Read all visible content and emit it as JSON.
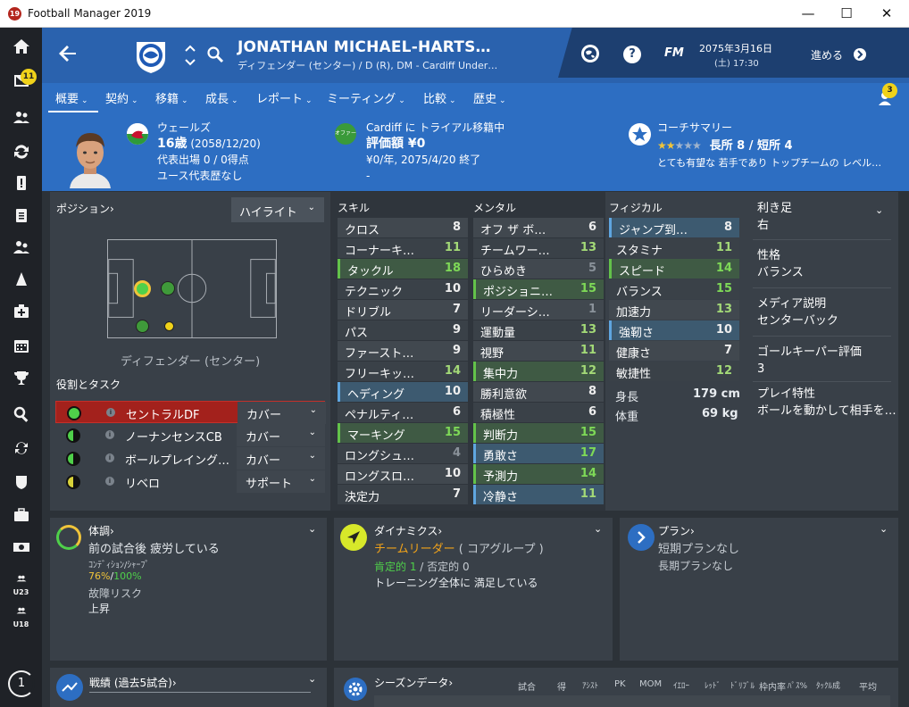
{
  "window": {
    "title": "Football Manager 2019",
    "app_icon": "19",
    "minimize": "—",
    "maximize": "☐",
    "close": "✕"
  },
  "sidebar": {
    "inbox_badge": "11",
    "level": "1",
    "u23": "U23",
    "u18": "U18"
  },
  "header": {
    "player_name": "JONATHAN MICHAEL-HARTS…",
    "player_sub": "ディフェンダー (センター) / D (R), DM - Cardiff Under…",
    "date": "2075年3月16日",
    "time": "(土) 17:30",
    "fm": "FM",
    "help": "?",
    "continue": "進める",
    "notif_badge": "3"
  },
  "tabs": [
    {
      "label": "概要"
    },
    {
      "label": "契約"
    },
    {
      "label": "移籍"
    },
    {
      "label": "成長"
    },
    {
      "label": "レポート"
    },
    {
      "label": "ミーティング"
    },
    {
      "label": "比較"
    },
    {
      "label": "歴史"
    }
  ],
  "bio": {
    "nation": "ウェールズ",
    "age": "16歳",
    "dob": "(2058/12/20)",
    "caps": "代表出場 0 / 0得点",
    "youth": "ユース代表歴なし"
  },
  "transfer": {
    "status": "Cardiff に トライアル移籍中",
    "value": "評価額 ¥0",
    "wage": "¥0/年, 2075/4/20 終了",
    "dash": "-",
    "badge": "オファー"
  },
  "coach": {
    "title": "コーチサマリー",
    "rating": "長所 8 / 短所 4",
    "summary": "とても有望な 若手であり トップチームの レベル…"
  },
  "position": {
    "title": "ポジション›",
    "highlight": "ハイライト",
    "pos_label": "ディフェンダー (センター)"
  },
  "roles": {
    "title": "役割とタスク",
    "items": [
      {
        "name": "セントラルDF",
        "duty": "カバー"
      },
      {
        "name": "ノーナンセンスCB",
        "duty": "カバー"
      },
      {
        "name": "ボールプレイング…",
        "duty": "カバー"
      },
      {
        "name": "リベロ",
        "duty": "サポート"
      }
    ]
  },
  "attributes": {
    "technical_title": "スキル",
    "mental_title": "メンタル",
    "physical_title": "フィジカル",
    "technical": [
      {
        "name": "クロス",
        "value": "8"
      },
      {
        "name": "コーナーキ…",
        "value": "11"
      },
      {
        "name": "タックル",
        "value": "18"
      },
      {
        "name": "テクニック",
        "value": "10"
      },
      {
        "name": "ドリブル",
        "value": "7"
      },
      {
        "name": "パス",
        "value": "9"
      },
      {
        "name": "ファースト…",
        "value": "9"
      },
      {
        "name": "フリーキッ…",
        "value": "14"
      },
      {
        "name": "ヘディング",
        "value": "10"
      },
      {
        "name": "ペナルティ…",
        "value": "6"
      },
      {
        "name": "マーキング",
        "value": "15"
      },
      {
        "name": "ロングシュ…",
        "value": "4"
      },
      {
        "name": "ロングスロ…",
        "value": "10"
      },
      {
        "name": "決定力",
        "value": "7"
      }
    ],
    "mental": [
      {
        "name": "オフ ザ ボ…",
        "value": "6"
      },
      {
        "name": "チームワー…",
        "value": "13"
      },
      {
        "name": "ひらめき",
        "value": "5"
      },
      {
        "name": "ポジショニ…",
        "value": "15"
      },
      {
        "name": "リーダーシ…",
        "value": "1"
      },
      {
        "name": "運動量",
        "value": "13"
      },
      {
        "name": "視野",
        "value": "11"
      },
      {
        "name": "集中力",
        "value": "12"
      },
      {
        "name": "勝利意欲",
        "value": "8"
      },
      {
        "name": "積極性",
        "value": "6"
      },
      {
        "name": "判断力",
        "value": "15"
      },
      {
        "name": "勇敢さ",
        "value": "17"
      },
      {
        "name": "予測力",
        "value": "14"
      },
      {
        "name": "冷静さ",
        "value": "11"
      }
    ],
    "physical": [
      {
        "name": "ジャンプ到…",
        "value": "8"
      },
      {
        "name": "スタミナ",
        "value": "11"
      },
      {
        "name": "スピード",
        "value": "14"
      },
      {
        "name": "バランス",
        "value": "15"
      },
      {
        "name": "加速力",
        "value": "13"
      },
      {
        "name": "強靭さ",
        "value": "10"
      },
      {
        "name": "健康さ",
        "value": "7"
      },
      {
        "name": "敏捷性",
        "value": "12"
      }
    ],
    "height_label": "身長",
    "height": "179 cm",
    "weight_label": "体重",
    "weight": "69 kg"
  },
  "side": {
    "foot_label": "利き足",
    "foot": "右",
    "personality_label": "性格",
    "personality": "バランス",
    "media_label": "メディア説明",
    "media": "センターバック",
    "gk_label": "ゴールキーパー評価",
    "gk": "3",
    "traits_label": "プレイ特性",
    "traits": "ボールを動かして相手を…"
  },
  "condition": {
    "title": "体調›",
    "status": "前の試合後 疲労している",
    "cond_label": "ｺﾝﾃﾞｨｼｮﾝ/ｼｬｰﾌﾟ",
    "cond": "76%",
    "sharp": "100%",
    "slash": "/",
    "injury_label": "故障リスク",
    "injury": "上昇"
  },
  "dynamics": {
    "title": "ダイナミクス›",
    "role": "チームリーダー",
    "group": "( コアグループ )",
    "pos": "肯定的 1",
    "neg": " / 否定的 0",
    "training": "トレーニング全体に 満足している"
  },
  "plans": {
    "title": "プラン›",
    "short": "短期プランなし",
    "long": "長期プランなし"
  },
  "form": {
    "title": "戦績 (過去5試合)›"
  },
  "season": {
    "title": "シーズンデータ›",
    "cols": [
      "試合",
      "得",
      "ｱｼｽﾄ",
      "PK",
      "MOM",
      "ｲｴﾛｰ",
      "ﾚｯﾄﾞ",
      "ﾄﾞﾘﾌﾞﾙ",
      "枠内率",
      "ﾊﾟｽ%",
      "ﾀｯｸﾙ成",
      "平均"
    ]
  }
}
